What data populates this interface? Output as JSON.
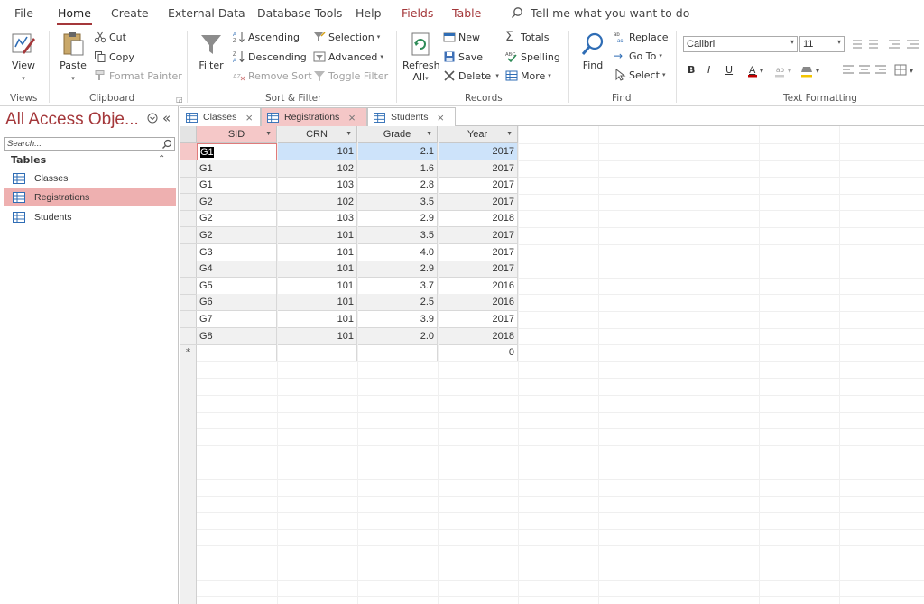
{
  "menu": {
    "tabs": [
      "File",
      "Home",
      "Create",
      "External Data",
      "Database Tools",
      "Help",
      "Fields",
      "Table"
    ],
    "active": "Home",
    "tell_me": "Tell me what you want to do"
  },
  "ribbon": {
    "views": {
      "view_label": "View",
      "group": "Views"
    },
    "clipboard": {
      "paste": "Paste",
      "cut": "Cut",
      "copy": "Copy",
      "format_painter": "Format Painter",
      "group": "Clipboard"
    },
    "sort_filter": {
      "filter": "Filter",
      "ascending": "Ascending",
      "descending": "Descending",
      "remove_sort": "Remove Sort",
      "selection": "Selection",
      "advanced": "Advanced",
      "toggle_filter": "Toggle Filter",
      "group": "Sort & Filter"
    },
    "records": {
      "refresh_all": "Refresh",
      "refresh_all_2": "All",
      "new": "New",
      "save": "Save",
      "delete": "Delete",
      "totals": "Totals",
      "spelling": "Spelling",
      "more": "More",
      "group": "Records"
    },
    "find": {
      "find": "Find",
      "replace": "Replace",
      "go_to": "Go To",
      "select": "Select",
      "group": "Find"
    },
    "text_formatting": {
      "font": "Calibri",
      "size": "11",
      "bold": "B",
      "italic": "I",
      "underline": "U",
      "group": "Text Formatting"
    }
  },
  "nav": {
    "title": "All Access Obje...",
    "search_placeholder": "Search...",
    "section": "Tables",
    "items": [
      {
        "label": "Classes",
        "selected": false
      },
      {
        "label": "Registrations",
        "selected": true
      },
      {
        "label": "Students",
        "selected": false
      }
    ]
  },
  "doc_tabs": [
    {
      "label": "Classes",
      "active": false
    },
    {
      "label": "Registrations",
      "active": true
    },
    {
      "label": "Students",
      "active": false
    }
  ],
  "table": {
    "columns": [
      "SID",
      "CRN",
      "Grade",
      "Year"
    ],
    "rows": [
      [
        "G1",
        "101",
        "2.1",
        "2017"
      ],
      [
        "G1",
        "102",
        "1.6",
        "2017"
      ],
      [
        "G1",
        "103",
        "2.8",
        "2017"
      ],
      [
        "G2",
        "102",
        "3.5",
        "2017"
      ],
      [
        "G2",
        "103",
        "2.9",
        "2018"
      ],
      [
        "G2",
        "101",
        "3.5",
        "2017"
      ],
      [
        "G3",
        "101",
        "4.0",
        "2017"
      ],
      [
        "G4",
        "101",
        "2.9",
        "2017"
      ],
      [
        "G5",
        "101",
        "3.7",
        "2016"
      ],
      [
        "G6",
        "101",
        "2.5",
        "2016"
      ],
      [
        "G7",
        "101",
        "3.9",
        "2017"
      ],
      [
        "G8",
        "101",
        "2.0",
        "2018"
      ]
    ],
    "new_row_marker": "*",
    "new_row_default_year": "0"
  },
  "colors": {
    "accent": "#a4373a",
    "tab_active": "#f4c7c7",
    "nav_selected": "#eeb0b0",
    "row_current": "#cde3fa"
  }
}
